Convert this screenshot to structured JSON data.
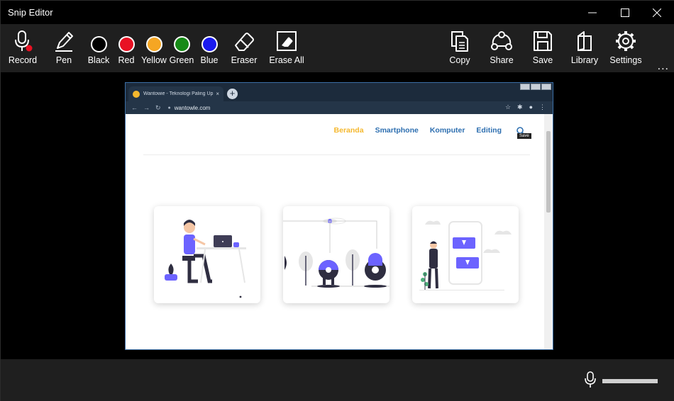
{
  "app": {
    "title": "Snip Editor"
  },
  "window_controls": [
    {
      "name": "minimize-button",
      "icon": "minimize-icon"
    },
    {
      "name": "maximize-button",
      "icon": "maximize-icon"
    },
    {
      "name": "close-button",
      "icon": "close-icon"
    }
  ],
  "toolbar": {
    "left": [
      {
        "id": "record",
        "label": "Record",
        "icon": "microphone-icon"
      },
      {
        "id": "pen",
        "label": "Pen",
        "icon": "pen-icon"
      },
      {
        "id": "black",
        "label": "Black",
        "color": "#000000"
      },
      {
        "id": "red",
        "label": "Red",
        "color": "#e81123"
      },
      {
        "id": "yellow",
        "label": "Yellow",
        "color": "#f5a623"
      },
      {
        "id": "green",
        "label": "Green",
        "color": "#168a16"
      },
      {
        "id": "blue",
        "label": "Blue",
        "color": "#1a1aee"
      },
      {
        "id": "eraser",
        "label": "Eraser",
        "icon": "eraser-icon"
      },
      {
        "id": "erase-all",
        "label": "Erase All",
        "icon": "erase-all-icon"
      }
    ],
    "right": [
      {
        "id": "copy",
        "label": "Copy",
        "icon": "copy-icon"
      },
      {
        "id": "share",
        "label": "Share",
        "icon": "share-icon"
      },
      {
        "id": "save",
        "label": "Save",
        "icon": "save-icon"
      },
      {
        "id": "library",
        "label": "Library",
        "icon": "library-icon"
      },
      {
        "id": "settings",
        "label": "Settings",
        "icon": "gear-icon"
      }
    ],
    "more": "..."
  },
  "snip": {
    "tab_title": "Wantowie - Teknologi Paling Up...",
    "tab_close": "×",
    "new_tab": "+",
    "url": "wantowle.com",
    "nav": {
      "active": "Beranda",
      "items": [
        "Smartphone",
        "Komputer",
        "Editing"
      ]
    },
    "tooltip": "Save"
  },
  "colors": {
    "accent": "#3b6ea5",
    "site_active": "#f5b82e",
    "site_nav": "#2e6fb0",
    "illustration": "#6c63ff"
  }
}
